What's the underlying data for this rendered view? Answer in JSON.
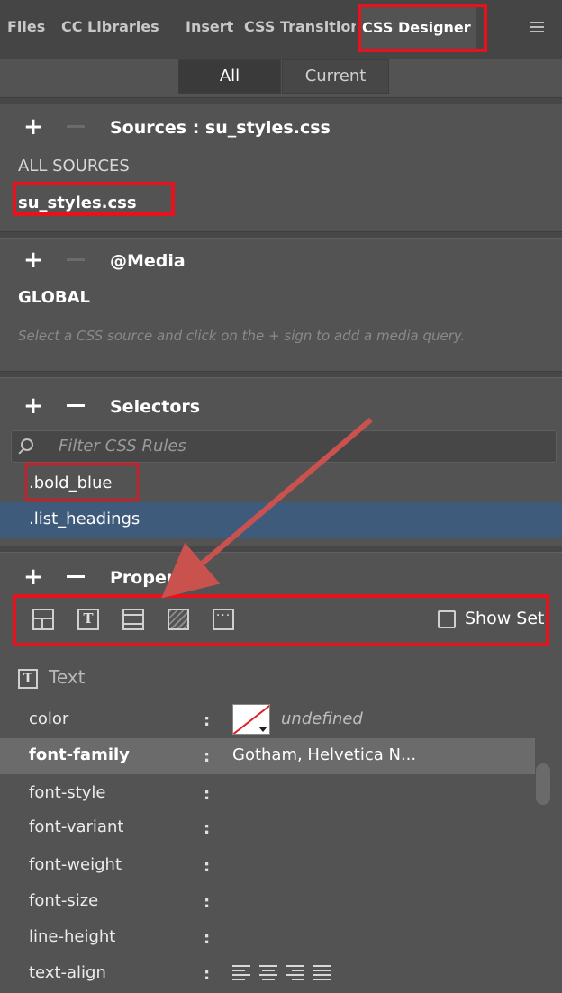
{
  "tabs": [
    {
      "label": "Files"
    },
    {
      "label": "CC Libraries"
    },
    {
      "label": "Insert"
    },
    {
      "label": "CSS Transitions"
    },
    {
      "label": "CSS Designer"
    }
  ],
  "view_toggle": {
    "all": "All",
    "current": "Current"
  },
  "sources": {
    "title": "Sources :  su_styles.css",
    "items": [
      "ALL SOURCES",
      "su_styles.css"
    ]
  },
  "media": {
    "title": "@Media",
    "global": "GLOBAL",
    "hint": "Select a CSS source and click on the + sign to add a media query."
  },
  "selectors": {
    "title": "Selectors",
    "filter_placeholder": "Filter CSS Rules",
    "items": [
      ".bold_blue",
      ".list_headings"
    ]
  },
  "properties": {
    "title": "Properties",
    "show_set_label": "Show Set",
    "category_text": "Text",
    "rows": [
      {
        "name": "color",
        "value": "undefined"
      },
      {
        "name": "font-family",
        "value": "Gotham, Helvetica N..."
      },
      {
        "name": "font-style",
        "value": ""
      },
      {
        "name": "font-variant",
        "value": ""
      },
      {
        "name": "font-weight",
        "value": ""
      },
      {
        "name": "font-size",
        "value": ""
      },
      {
        "name": "line-height",
        "value": ""
      },
      {
        "name": "text-align",
        "value": ""
      }
    ]
  },
  "colors": {
    "panel_bg": "#535353",
    "selected_row": "#3e5b7c",
    "highlight_row": "#6b6b6b",
    "annotation_red": "#e8111d",
    "arrow": "#c9524f"
  }
}
